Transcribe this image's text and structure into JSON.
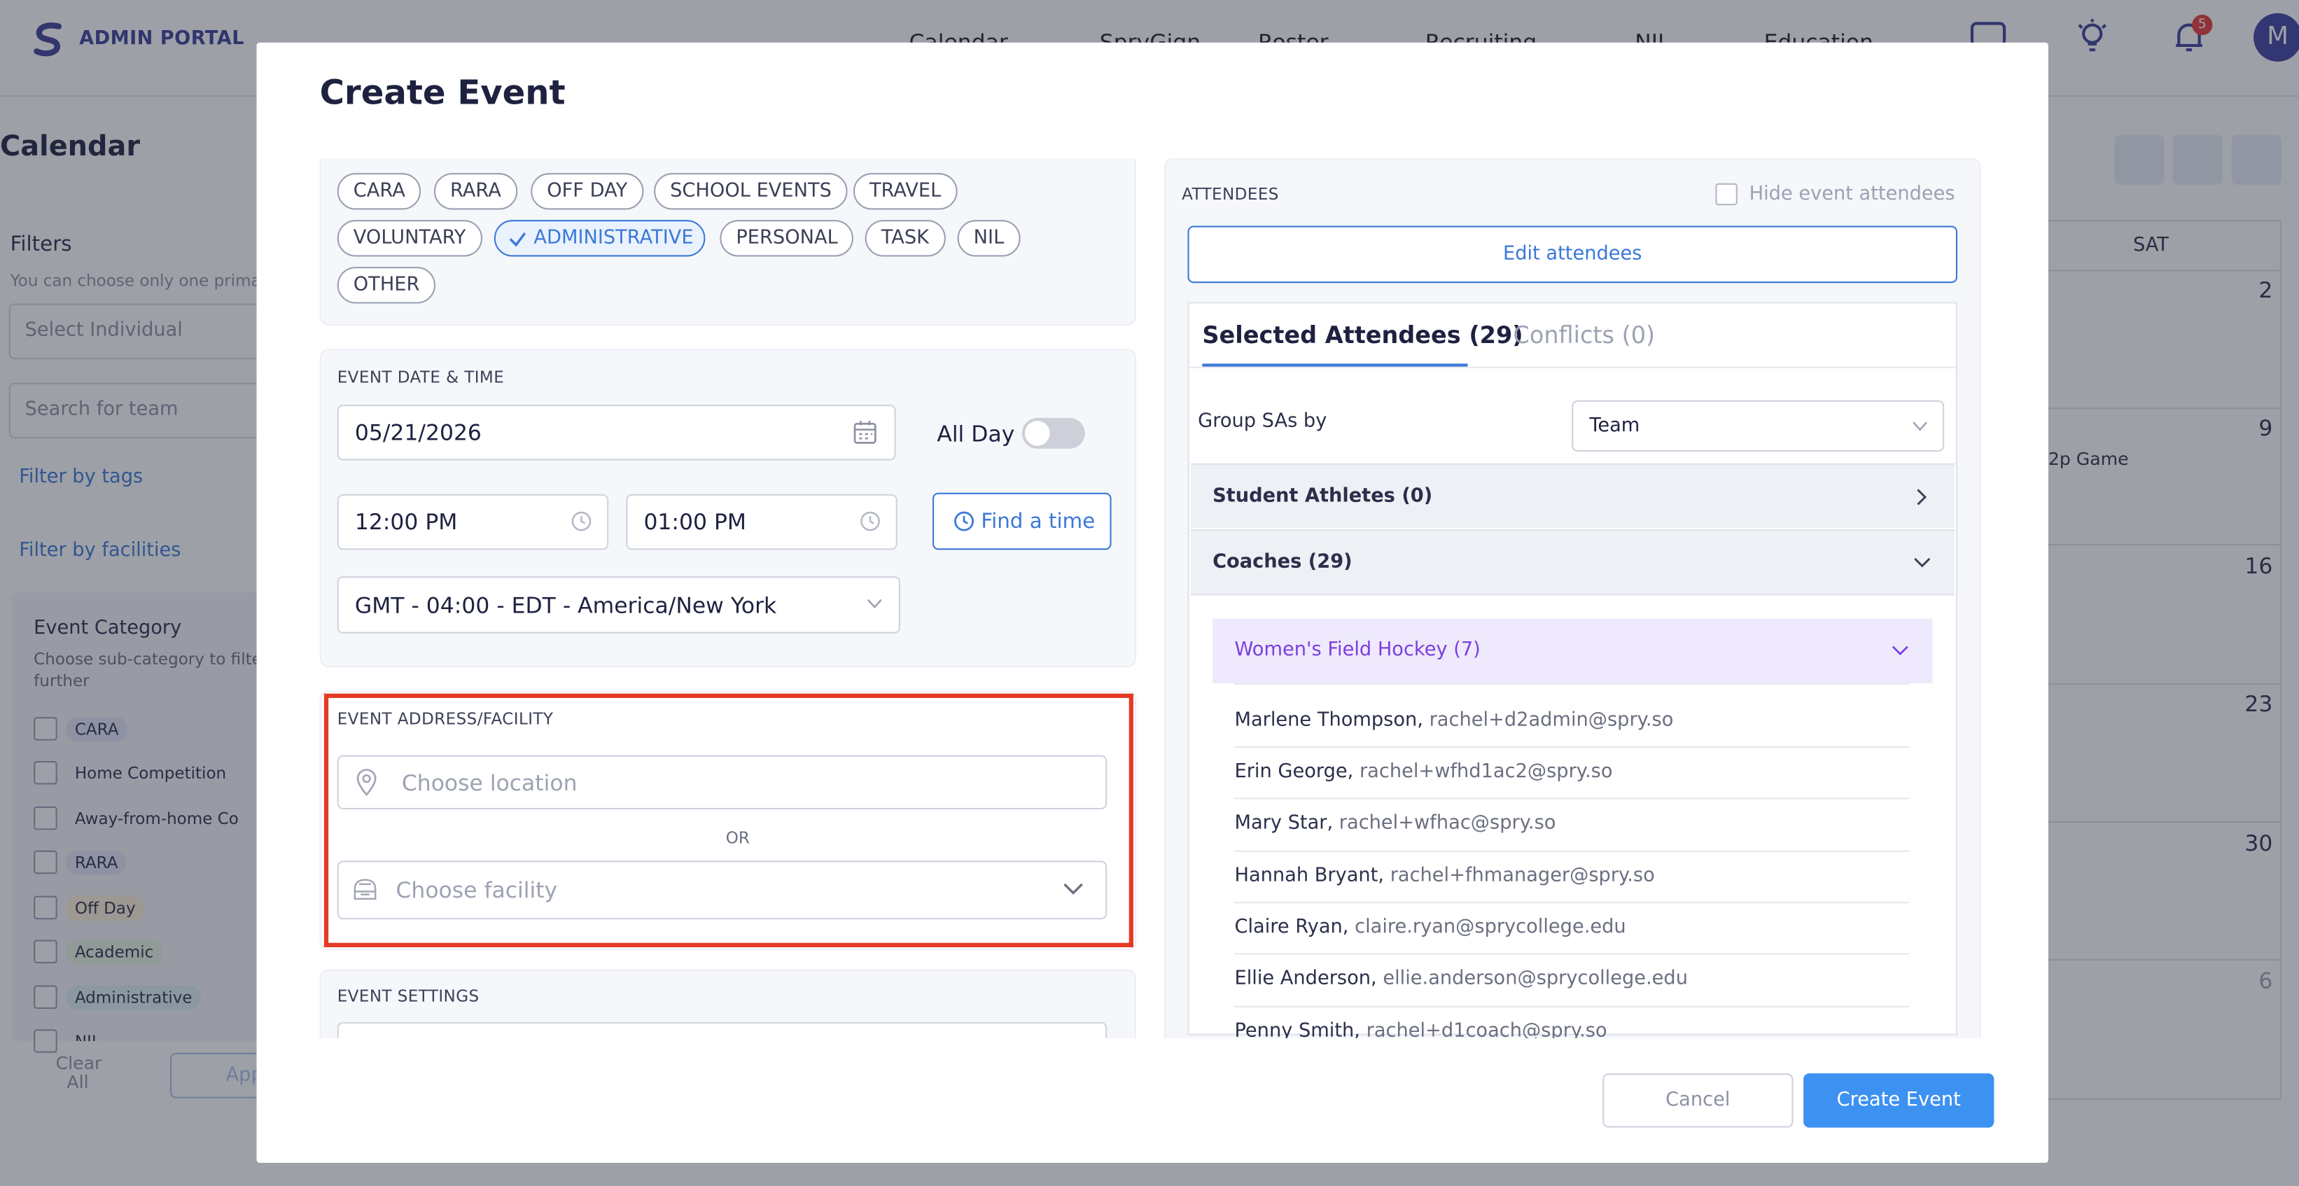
{
  "app": {
    "brand": "ADMIN PORTAL",
    "nav": [
      "Calendar",
      "SpryGign",
      "Roster",
      "Recruiting",
      "NIL",
      "Education"
    ],
    "notification_count": "5",
    "avatar_initial": "M"
  },
  "background": {
    "page_title": "Calendar",
    "filters_title": "Filters",
    "filters_hint": "You can choose only one primar",
    "select_individual_placeholder": "Select Individual",
    "search_team_placeholder": "Search for team",
    "filter_by_tags": "Filter by tags",
    "filter_by_facilities": "Filter by facilities",
    "event_category_title": "Event Category",
    "event_category_hint": "Choose sub-category to filte further",
    "categories": [
      "CARA",
      "Home Competition",
      "Away-from-home Co",
      "RARA",
      "Off Day",
      "Academic",
      "Administrative",
      "NIL"
    ],
    "clear_all": "Clear All",
    "apply": "App",
    "calendar_day": "SAT",
    "calendar_dates": [
      "2",
      "9",
      "16",
      "23",
      "30",
      "6"
    ],
    "calendar_event": "2p Game"
  },
  "modal": {
    "title": "Create Event",
    "event_types": [
      "CARA",
      "RARA",
      "OFF DAY",
      "SCHOOL EVENTS",
      "TRAVEL",
      "VOLUNTARY",
      "ADMINISTRATIVE",
      "PERSONAL",
      "TASK",
      "NIL",
      "OTHER"
    ],
    "selected_type": "ADMINISTRATIVE",
    "date_time": {
      "label": "EVENT DATE & TIME",
      "date": "05/21/2026",
      "all_day_label": "All Day",
      "all_day": false,
      "start_time": "12:00 PM",
      "end_time": "01:00 PM",
      "find_time": "Find a time",
      "timezone": "GMT - 04:00 - EDT - America/New York"
    },
    "address": {
      "label": "EVENT ADDRESS/FACILITY",
      "location_placeholder": "Choose location",
      "or": "OR",
      "facility_placeholder": "Choose facility"
    },
    "settings_label": "EVENT SETTINGS",
    "attendees": {
      "label": "ATTENDEES",
      "hide_label": "Hide event attendees",
      "edit_button": "Edit attendees",
      "tab_selected": "Selected Attendees (29)",
      "tab_conflicts": "Conflicts (0)",
      "group_label": "Group SAs by",
      "group_value": "Team",
      "student_athletes": "Student Athletes (0)",
      "coaches": "Coaches (29)",
      "team": "Women's Field Hockey (7)",
      "people": [
        {
          "name": "Marlene Thompson,",
          "email": "rachel+d2admin@spry.so"
        },
        {
          "name": "Erin George,",
          "email": "rachel+wfhd1ac2@spry.so"
        },
        {
          "name": "Mary Star,",
          "email": "rachel+wfhac@spry.so"
        },
        {
          "name": "Hannah Bryant,",
          "email": "rachel+fhmanager@spry.so"
        },
        {
          "name": "Claire Ryan,",
          "email": "claire.ryan@sprycollege.edu"
        },
        {
          "name": "Ellie Anderson,",
          "email": "ellie.anderson@sprycollege.edu"
        },
        {
          "name": "Penny Smith,",
          "email": "rachel+d1coach@spry.so"
        }
      ]
    },
    "cancel": "Cancel",
    "create": "Create Event"
  },
  "colors": {
    "accent": "#3a78d8",
    "primary_button": "#3d91f0",
    "highlight_border": "#e53a25",
    "team_highlight": "#7b3fe0"
  }
}
